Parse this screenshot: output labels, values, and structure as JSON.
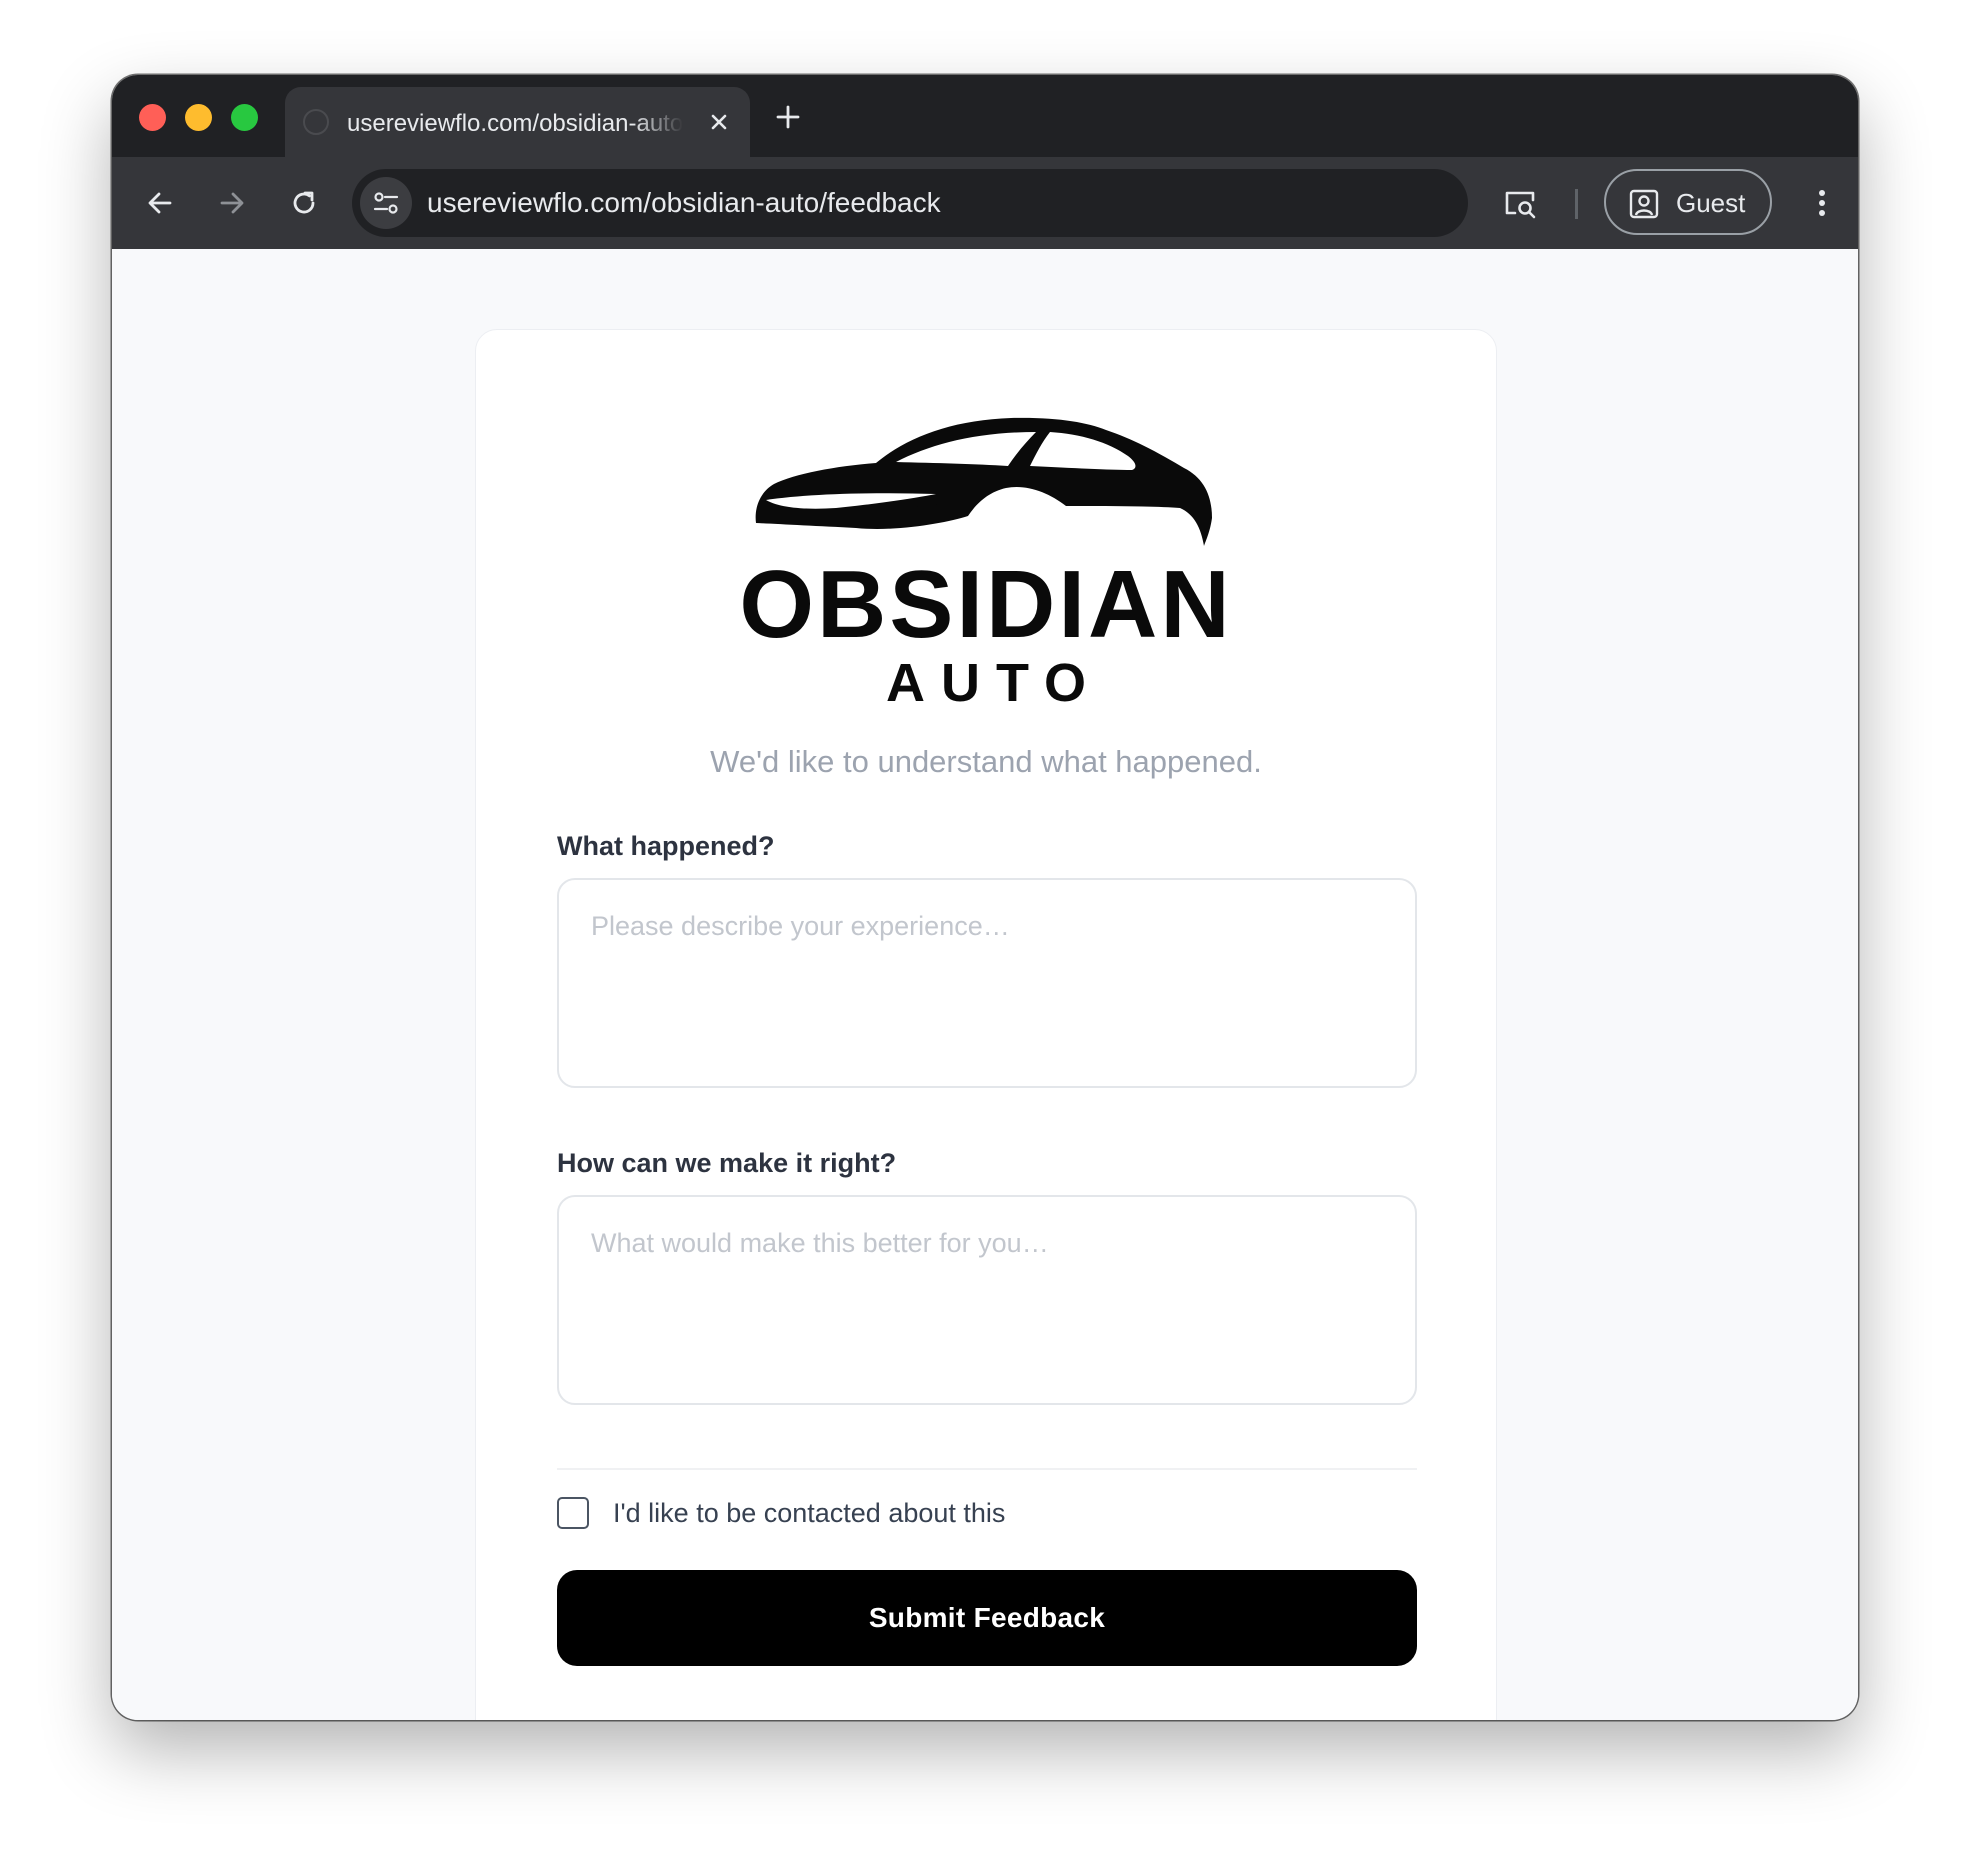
{
  "browser": {
    "tab_title": "usereviewflo.com/obsidian-auto/feedback",
    "url": "usereviewflo.com/obsidian-auto/feedback",
    "profile_label": "Guest"
  },
  "brand": {
    "name": "OBSIDIAN",
    "sub": "AUTO"
  },
  "page": {
    "subtitle": "We'd like to understand what happened."
  },
  "form": {
    "what_happened": {
      "label": "What happened?",
      "placeholder": "Please describe your experience…",
      "value": ""
    },
    "make_it_right": {
      "label": "How can we make it right?",
      "placeholder": "What would make this better for you…",
      "value": ""
    },
    "contact": {
      "label": "I'd like to be contacted about this",
      "checked": false
    },
    "submit_label": "Submit Feedback"
  },
  "colors": {
    "primary_button": "#000000",
    "page_background": "#f8f9fb",
    "browser_chrome": "#35363a"
  },
  "icons": {
    "tab_close": "close-icon",
    "new_tab": "plus-icon",
    "back": "arrow-left-icon",
    "forward": "arrow-right-icon",
    "reload": "reload-icon",
    "site_info": "tune-icon",
    "lens": "search-page-icon",
    "profile": "person-icon",
    "menu": "more-vertical-icon"
  }
}
